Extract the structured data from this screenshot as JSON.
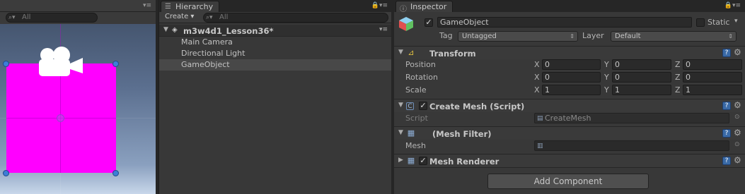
{
  "scene": {
    "search_placeholder": "All"
  },
  "hierarchy": {
    "tab_label": "Hierarchy",
    "create_label": "Create",
    "search_placeholder": "All",
    "scene_name": "m3w4d1_Lesson36*",
    "items": [
      "Main Camera",
      "Directional Light",
      "GameObject"
    ],
    "selected_index": 2
  },
  "inspector": {
    "tab_label": "Inspector",
    "object_name": "GameObject",
    "active": true,
    "static_label": "Static",
    "tag_label": "Tag",
    "tag_value": "Untagged",
    "layer_label": "Layer",
    "layer_value": "Default",
    "transform": {
      "title": "Transform",
      "position_label": "Position",
      "rotation_label": "Rotation",
      "scale_label": "Scale",
      "x_label": "X",
      "y_label": "Y",
      "z_label": "Z",
      "position": [
        "0",
        "0",
        "0"
      ],
      "rotation": [
        "0",
        "0",
        "0"
      ],
      "scale": [
        "1",
        "1",
        "1"
      ]
    },
    "create_mesh": {
      "title": "Create Mesh (Script)",
      "script_label": "Script",
      "script_value": "CreateMesh"
    },
    "mesh_filter": {
      "title": "(Mesh Filter)",
      "mesh_label": "Mesh"
    },
    "mesh_renderer": {
      "title": "Mesh Renderer"
    },
    "add_component_label": "Add Component"
  },
  "colors": {
    "magenta": "#ff00ff",
    "handle_blue": "#3e7ed6",
    "panel_bg": "#383838"
  }
}
